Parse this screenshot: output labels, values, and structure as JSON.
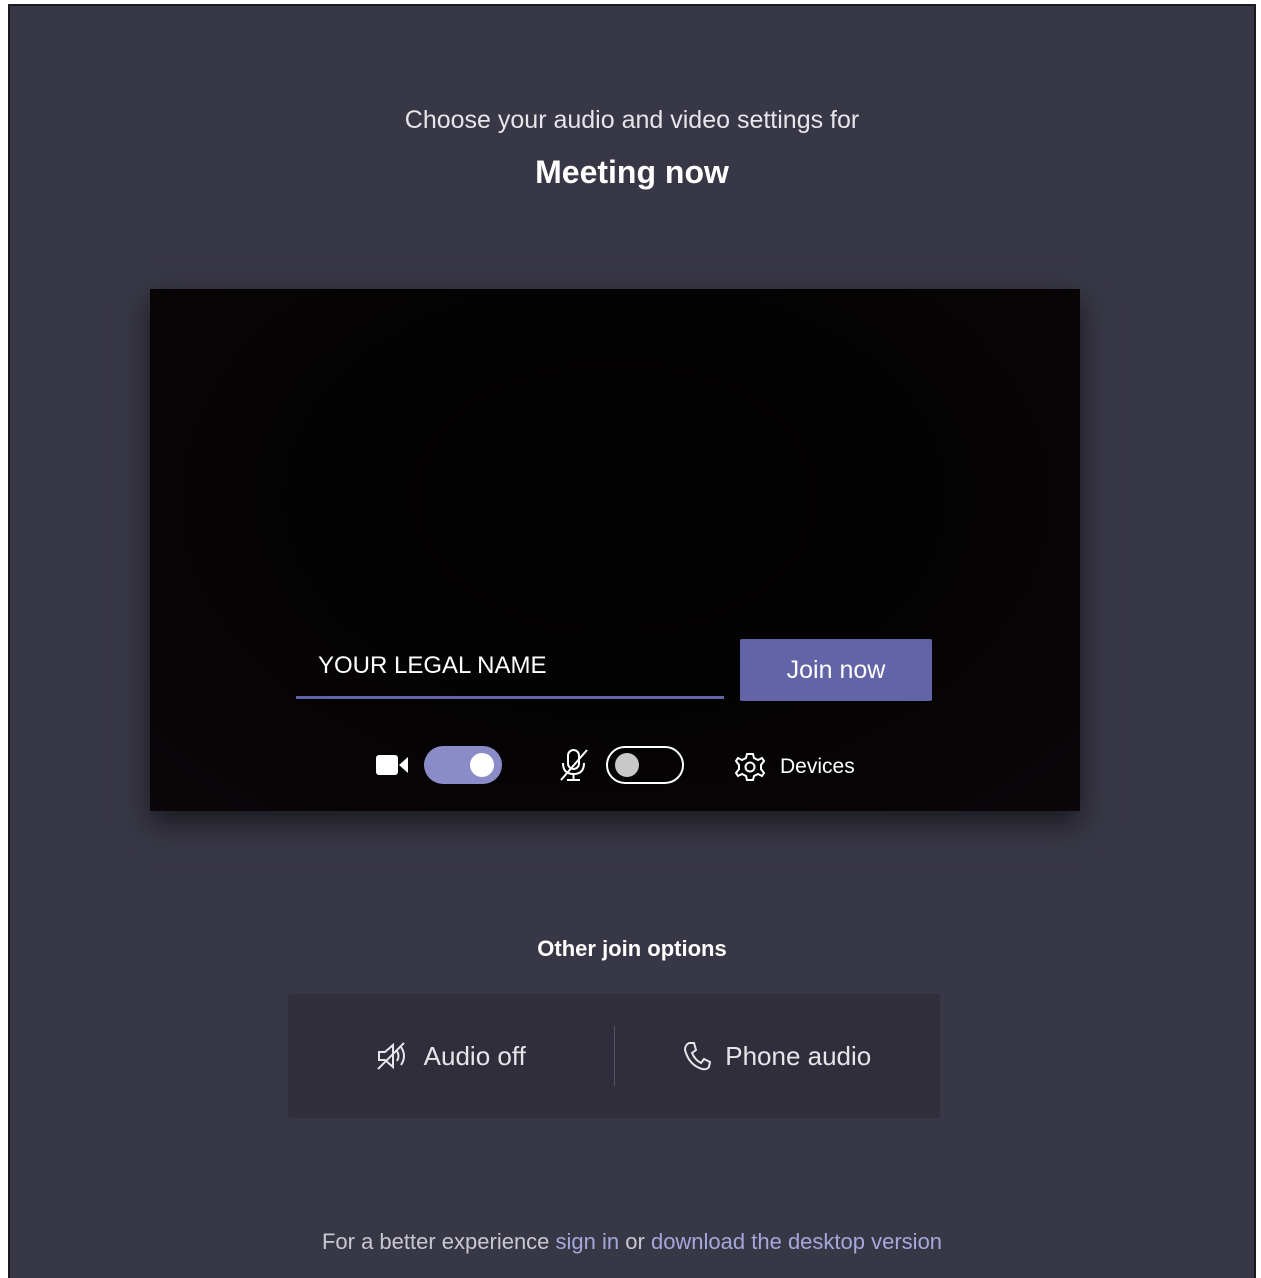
{
  "header": {
    "subtitle": "Choose your audio and video settings for",
    "meeting_title": "Meeting now"
  },
  "preview": {
    "name_input": {
      "value": "",
      "placeholder": "YOUR LEGAL NAME"
    },
    "join_button": "Join now",
    "camera": {
      "icon": "video-camera-icon",
      "on": true
    },
    "microphone": {
      "icon": "mic-off-icon",
      "on": false
    },
    "devices": {
      "icon": "gear-icon",
      "label": "Devices"
    }
  },
  "other_options": {
    "title": "Other join options",
    "audio_off": {
      "icon": "speaker-off-icon",
      "label": "Audio off"
    },
    "phone_audio": {
      "icon": "phone-icon",
      "label": "Phone audio"
    }
  },
  "footer": {
    "prefix": "For a better experience",
    "sign_in": "sign in",
    "middle": "or",
    "download": "download the desktop version"
  },
  "colors": {
    "background": "#383745",
    "accent": "#6264a7",
    "toggle_on": "#8b8cc7",
    "link": "#a6a7dc"
  }
}
